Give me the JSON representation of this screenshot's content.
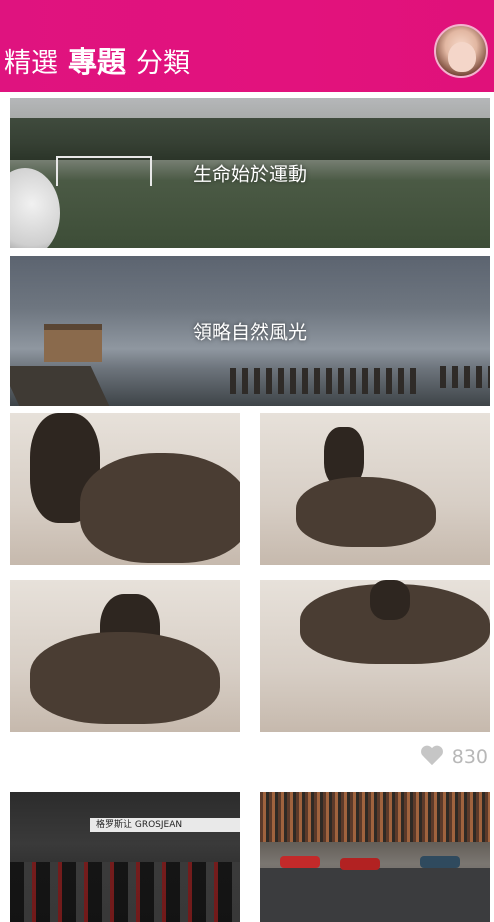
{
  "header": {
    "tabs": [
      {
        "label": "精選",
        "active": false
      },
      {
        "label": "專題",
        "active": true
      },
      {
        "label": "分類",
        "active": false
      }
    ],
    "accent_color": "#e0137c"
  },
  "banners": [
    {
      "caption": "生命始於運動"
    },
    {
      "caption": "領略自然風光"
    }
  ],
  "gallery": {
    "likes": "830"
  },
  "next_gallery": {
    "strip_text": "格罗斯让 GROSJEAN"
  }
}
